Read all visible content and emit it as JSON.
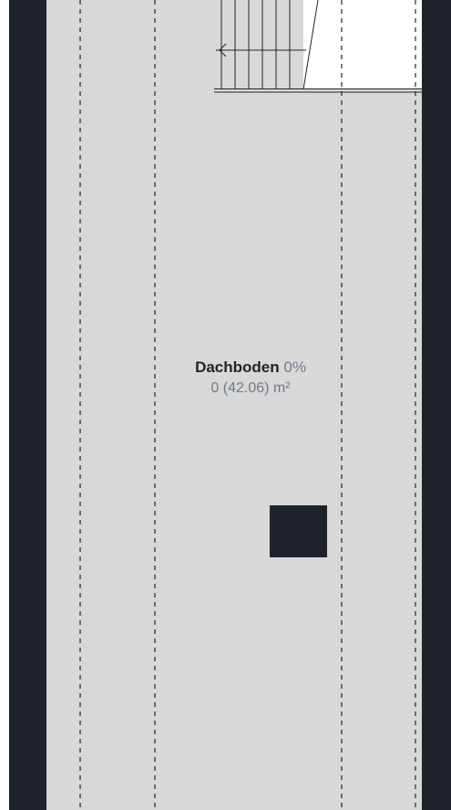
{
  "room": {
    "name": "Dachboden",
    "percent": "0%",
    "area": "0 (42.06) m²"
  },
  "colors": {
    "wall": "#1e232b",
    "floor": "#d8d8d8",
    "label_primary": "#1e232b",
    "label_secondary": "#6f7c89",
    "background": "#ffffff"
  },
  "icons": {
    "stairs": "stairs-icon",
    "stair_direction": "arrow-left-icon"
  }
}
